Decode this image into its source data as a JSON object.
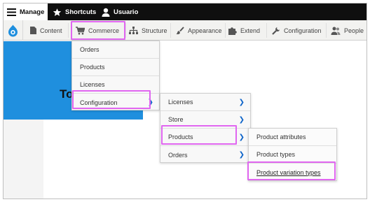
{
  "toolbar": {
    "manage_label": "Manage",
    "shortcuts_label": "Shortcuts",
    "user_label": "Usuario"
  },
  "tray": {
    "items": [
      {
        "label": "Content",
        "icon": "document-icon"
      },
      {
        "label": "Commerce",
        "icon": "cart-icon"
      },
      {
        "label": "Structure",
        "icon": "sitemap-icon"
      },
      {
        "label": "Appearance",
        "icon": "paint-brush-icon"
      },
      {
        "label": "Extend",
        "icon": "puzzle-icon"
      },
      {
        "label": "Configuration",
        "icon": "wrench-icon"
      },
      {
        "label": "People",
        "icon": "people-icon"
      }
    ]
  },
  "banner": {
    "text": "To"
  },
  "menus": {
    "commerce": [
      "Orders",
      "Products",
      "Licenses",
      "Configuration"
    ],
    "configuration": [
      "Licenses",
      "Store",
      "Products",
      "Orders"
    ],
    "products": [
      "Product attributes",
      "Product types",
      "Product variation types"
    ]
  },
  "colors": {
    "toolbar_bg": "#0f0f0f",
    "banner": "#1f8fde",
    "highlight": "#e066f0",
    "arrow": "#0d64c9"
  }
}
